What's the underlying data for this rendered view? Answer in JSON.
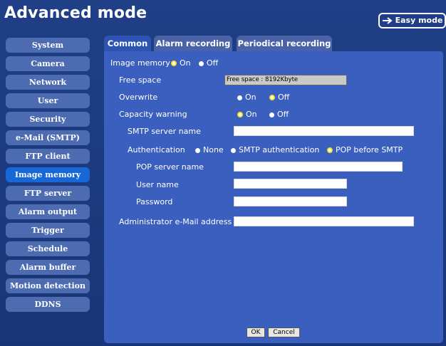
{
  "header": {
    "title": "Advanced mode",
    "easy_mode_label": "Easy mode"
  },
  "sidebar": {
    "items": [
      {
        "label": "System"
      },
      {
        "label": "Camera"
      },
      {
        "label": "Network"
      },
      {
        "label": "User"
      },
      {
        "label": "Security"
      },
      {
        "label": "e-Mail (SMTP)"
      },
      {
        "label": "FTP client"
      },
      {
        "label": "Image memory",
        "active": true
      },
      {
        "label": "FTP server"
      },
      {
        "label": "Alarm output"
      },
      {
        "label": "Trigger"
      },
      {
        "label": "Schedule"
      },
      {
        "label": "Alarm buffer"
      },
      {
        "label": "Motion detection"
      },
      {
        "label": "DDNS"
      }
    ]
  },
  "tabs": [
    {
      "label": "Common",
      "active": true
    },
    {
      "label": "Alarm recording"
    },
    {
      "label": "Periodical recording"
    }
  ],
  "form": {
    "image_memory": {
      "label": "Image memory",
      "on": "On",
      "off": "Off",
      "selected": "On"
    },
    "free_space": {
      "label": "Free space",
      "value": "Free space : 8192Kbyte"
    },
    "overwrite": {
      "label": "Overwrite",
      "on": "On",
      "off": "Off",
      "selected": "Off"
    },
    "capacity_warning": {
      "label": "Capacity warning",
      "on": "On",
      "off": "Off",
      "selected": "On"
    },
    "smtp_server_name": {
      "label": "SMTP server name",
      "value": ""
    },
    "authentication": {
      "label": "Authentication",
      "none": "None",
      "smtp": "SMTP authentication",
      "pop": "POP before SMTP",
      "selected": "POP before SMTP"
    },
    "pop_server_name": {
      "label": "POP server name",
      "value": ""
    },
    "user_name": {
      "label": "User name",
      "value": ""
    },
    "password": {
      "label": "Password",
      "value": ""
    },
    "admin_email": {
      "label": "Administrator e-Mail address",
      "value": ""
    },
    "ok_label": "OK",
    "cancel_label": "Cancel"
  },
  "colors": {
    "background": "#1f3f86",
    "panel": "#3a5fbe",
    "sidebar_item": "#4c6bb0",
    "sidebar_active": "#1767d6",
    "selected_radio": "#f2e227"
  }
}
